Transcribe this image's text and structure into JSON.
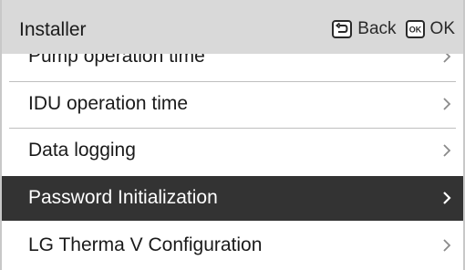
{
  "header": {
    "title": "Installer",
    "back_label": "Back",
    "ok_label": "OK",
    "ok_key_glyph": "OK"
  },
  "menu": {
    "items": [
      {
        "label": "Pump operation time",
        "selected": false
      },
      {
        "label": "IDU operation time",
        "selected": false
      },
      {
        "label": "Data logging",
        "selected": false
      },
      {
        "label": "Password Initialization",
        "selected": true
      },
      {
        "label": "LG Therma V Configuration",
        "selected": false
      }
    ]
  },
  "colors": {
    "header_bg": "#d9d9d9",
    "selected_bg": "#333333",
    "selected_text": "#ffffff",
    "text": "#1a1a1a",
    "chevron": "#8a8a8a"
  }
}
